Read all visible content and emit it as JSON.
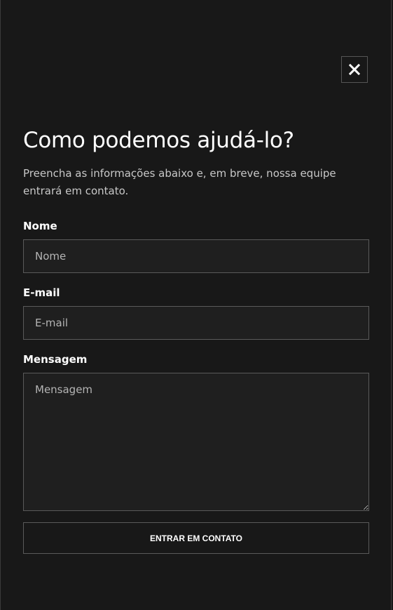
{
  "modal": {
    "close_icon": "close-x-icon",
    "title": "Como podemos ajudá-lo?",
    "subtitle": "Preencha as informações abaixo e, em breve, nossa equipe entrará em contato.",
    "fields": {
      "name": {
        "label": "Nome",
        "placeholder": "Nome",
        "value": ""
      },
      "email": {
        "label": "E-mail",
        "placeholder": "E-mail",
        "value": ""
      },
      "message": {
        "label": "Mensagem",
        "placeholder": "Mensagem",
        "value": ""
      }
    },
    "submit_label": "ENTRAR EM CONTATO"
  },
  "colors": {
    "background": "#181818",
    "field_background": "#1f1f1f",
    "border": "#5a5a5a",
    "text": "#ffffff"
  }
}
